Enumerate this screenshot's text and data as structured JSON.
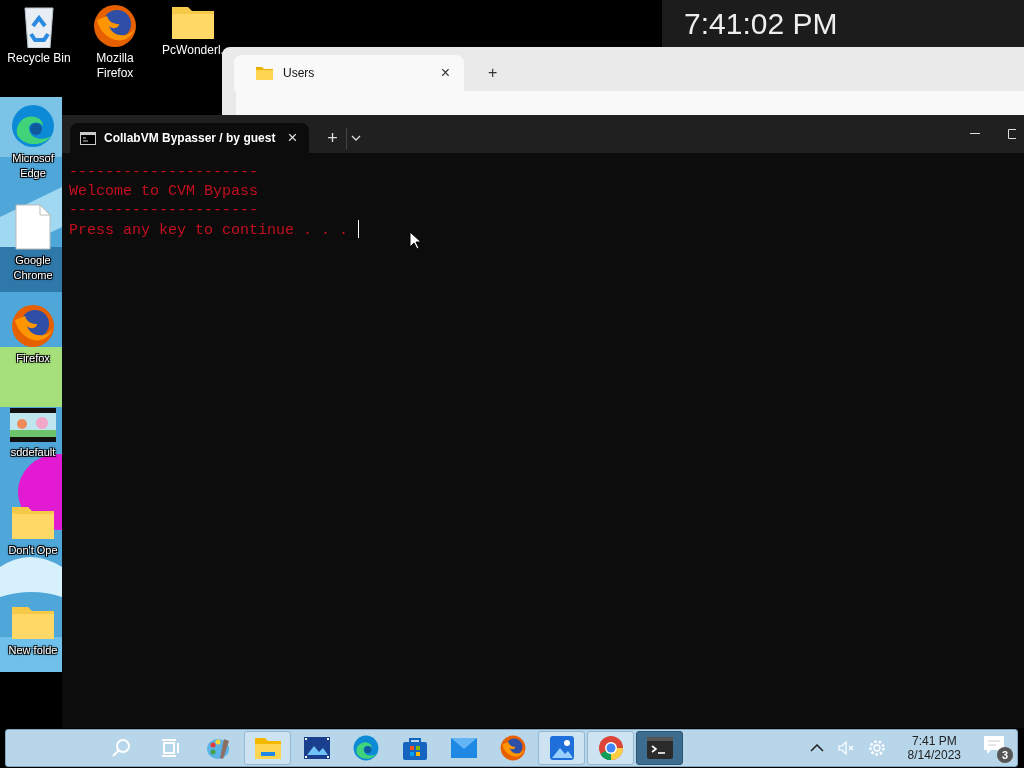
{
  "desktop_icons": [
    {
      "label": "Recycle Bin",
      "kind": "recycle"
    },
    {
      "label": "Mozilla Firefox",
      "kind": "firefox"
    },
    {
      "label": "PcWonderl.",
      "kind": "folder"
    },
    {
      "label": "Microsof Edge",
      "kind": "edge"
    },
    {
      "label": "Google Chrome",
      "kind": "file"
    },
    {
      "label": "Firefox",
      "kind": "firefox"
    },
    {
      "label": "sddefault",
      "kind": "picture"
    },
    {
      "label": "Don't Ope",
      "kind": "folder"
    },
    {
      "label": "New folde",
      "kind": "folder"
    }
  ],
  "clock_window": {
    "time": "7:41:02 PM"
  },
  "explorer_window": {
    "tabs": [
      {
        "label": "Users",
        "selected": true,
        "close": "×"
      }
    ],
    "new_tab": "+"
  },
  "terminal_window": {
    "tabs": [
      {
        "label": "CollabVM Bypasser / by guest",
        "selected": true,
        "close": "×"
      }
    ],
    "new_tab": "+",
    "lines": [
      "---------------------",
      "Welcome to CVM Bypass",
      "---------------------",
      "Press any key to continue . . . "
    ]
  },
  "taskbar": {
    "items": [
      {
        "kind": "search",
        "open": false,
        "selected": false
      },
      {
        "kind": "taskview",
        "open": false,
        "selected": false
      },
      {
        "kind": "paint",
        "open": false,
        "selected": false
      },
      {
        "kind": "explorer",
        "open": true,
        "selected": false
      },
      {
        "kind": "movie",
        "open": false,
        "selected": false
      },
      {
        "kind": "edge",
        "open": false,
        "selected": false
      },
      {
        "kind": "store",
        "open": false,
        "selected": false
      },
      {
        "kind": "mail",
        "open": false,
        "selected": false
      },
      {
        "kind": "firefox",
        "open": false,
        "selected": false
      },
      {
        "kind": "photos",
        "open": true,
        "selected": false
      },
      {
        "kind": "chrome",
        "open": true,
        "selected": false
      },
      {
        "kind": "terminal",
        "open": true,
        "selected": true
      }
    ],
    "tray": {
      "muted": true,
      "time": "7:41 PM",
      "date": "8/14/2023",
      "notifications": "3"
    }
  }
}
